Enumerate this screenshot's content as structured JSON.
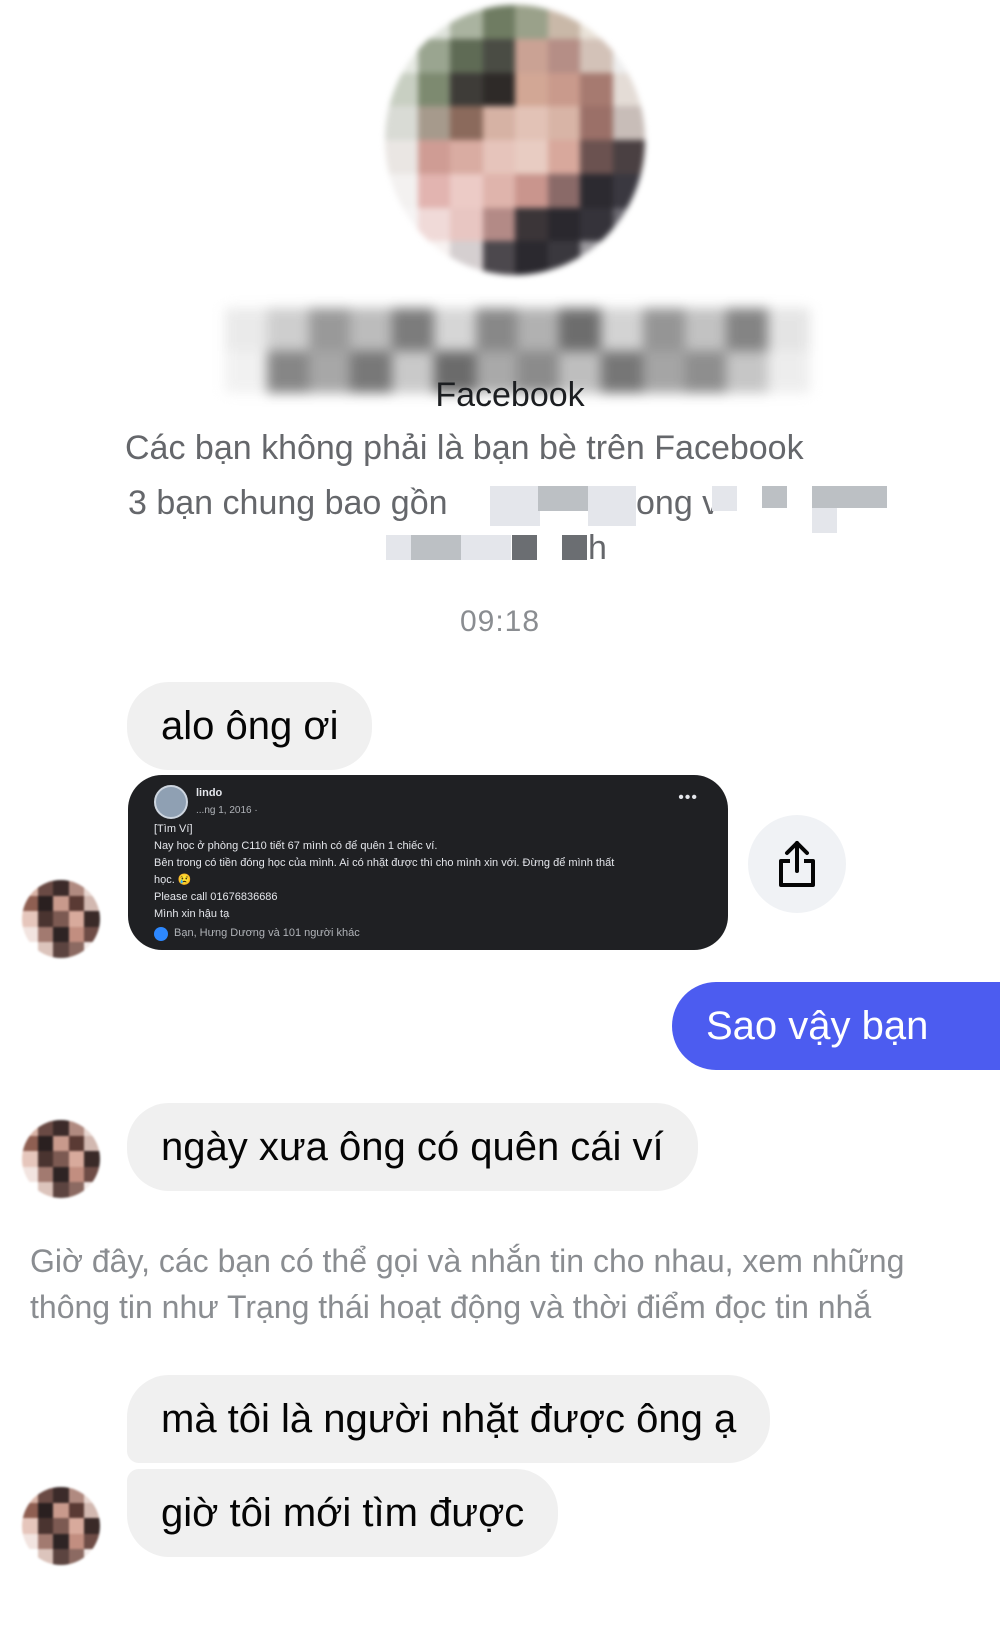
{
  "header": {
    "name_partial": "Facebook",
    "not_friends": "Các bạn không phải là bạn bè trên Facebook",
    "mutual_prefix": "3 bạn chung bao gồn",
    "mutual_mid": "ong v",
    "mutual_suffix": "h"
  },
  "timestamp": "09:18",
  "messages": [
    {
      "direction": "incoming",
      "text": "alo ông ơi"
    },
    {
      "direction": "outgoing",
      "text": "Sao vậy bạn"
    },
    {
      "direction": "incoming",
      "text": "ngày xưa ông có quên cái ví"
    },
    {
      "direction": "incoming",
      "text": "mà tôi là người nhặt được ông ạ"
    },
    {
      "direction": "incoming",
      "text": "giờ tôi mới tìm được"
    }
  ],
  "shared_post": {
    "author": "lindo",
    "date": "...ng 1, 2016 ·",
    "more": "•••",
    "lines": [
      "[Tìm Ví]",
      "Nay học ở phòng C110 tiết 67 mình có để quên 1 chiếc ví.",
      "Bên trong có tiền đóng học của mình. Ai có nhặt được thì cho mình xin với. Đừng để mình thất",
      "học. 😢",
      "Please call 01676836686",
      "Mình xin hậu tạ"
    ],
    "reactions": "Bạn, Hưng Dương và 101 người khác"
  },
  "notice": {
    "line1": "Giờ đây, các bạn có thể gọi và nhắn tin cho nhau, xem những",
    "line2": "thông tin như Trạng thái hoạt động và thời điểm đọc tin nhắ"
  },
  "colors": {
    "outgoing_bubble": "#4c5cf0",
    "incoming_bubble": "#f0f0f0",
    "secondary_text": "#65676b"
  },
  "icons": {
    "share": "share-icon"
  }
}
